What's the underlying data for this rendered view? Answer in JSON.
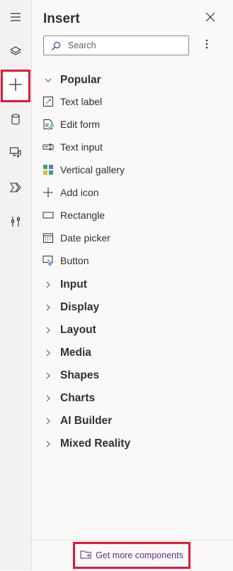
{
  "rail": {
    "items": [
      {
        "name": "menu",
        "icon": "hamburger-menu-icon"
      },
      {
        "name": "tree-view",
        "icon": "layers-icon"
      },
      {
        "name": "insert",
        "icon": "plus-icon",
        "active": true
      },
      {
        "name": "data",
        "icon": "database-icon"
      },
      {
        "name": "media",
        "icon": "media-icon"
      },
      {
        "name": "power-automate",
        "icon": "power-automate-icon"
      },
      {
        "name": "advanced-tools",
        "icon": "tools-icon"
      }
    ]
  },
  "panel": {
    "title": "Insert",
    "search_placeholder": "Search",
    "popular": {
      "label": "Popular",
      "items": [
        {
          "label": "Text label",
          "icon": "text-label-icon"
        },
        {
          "label": "Edit form",
          "icon": "edit-form-icon"
        },
        {
          "label": "Text input",
          "icon": "text-input-icon"
        },
        {
          "label": "Vertical gallery",
          "icon": "gallery-icon"
        },
        {
          "label": "Add icon",
          "icon": "plus-icon"
        },
        {
          "label": "Rectangle",
          "icon": "rectangle-icon"
        },
        {
          "label": "Date picker",
          "icon": "calendar-icon"
        },
        {
          "label": "Button",
          "icon": "button-icon"
        }
      ]
    },
    "sections": [
      {
        "label": "Input"
      },
      {
        "label": "Display"
      },
      {
        "label": "Layout"
      },
      {
        "label": "Media"
      },
      {
        "label": "Shapes"
      },
      {
        "label": "Charts"
      },
      {
        "label": "AI Builder"
      },
      {
        "label": "Mixed Reality"
      }
    ]
  },
  "footer": {
    "get_more_label": "Get more components"
  },
  "colors": {
    "highlight": "#e3193a",
    "link": "#5c2e91",
    "gallery_teal": "#3aa675",
    "gallery_blue": "#4a7fc1",
    "gallery_yellow": "#e8b63a"
  }
}
